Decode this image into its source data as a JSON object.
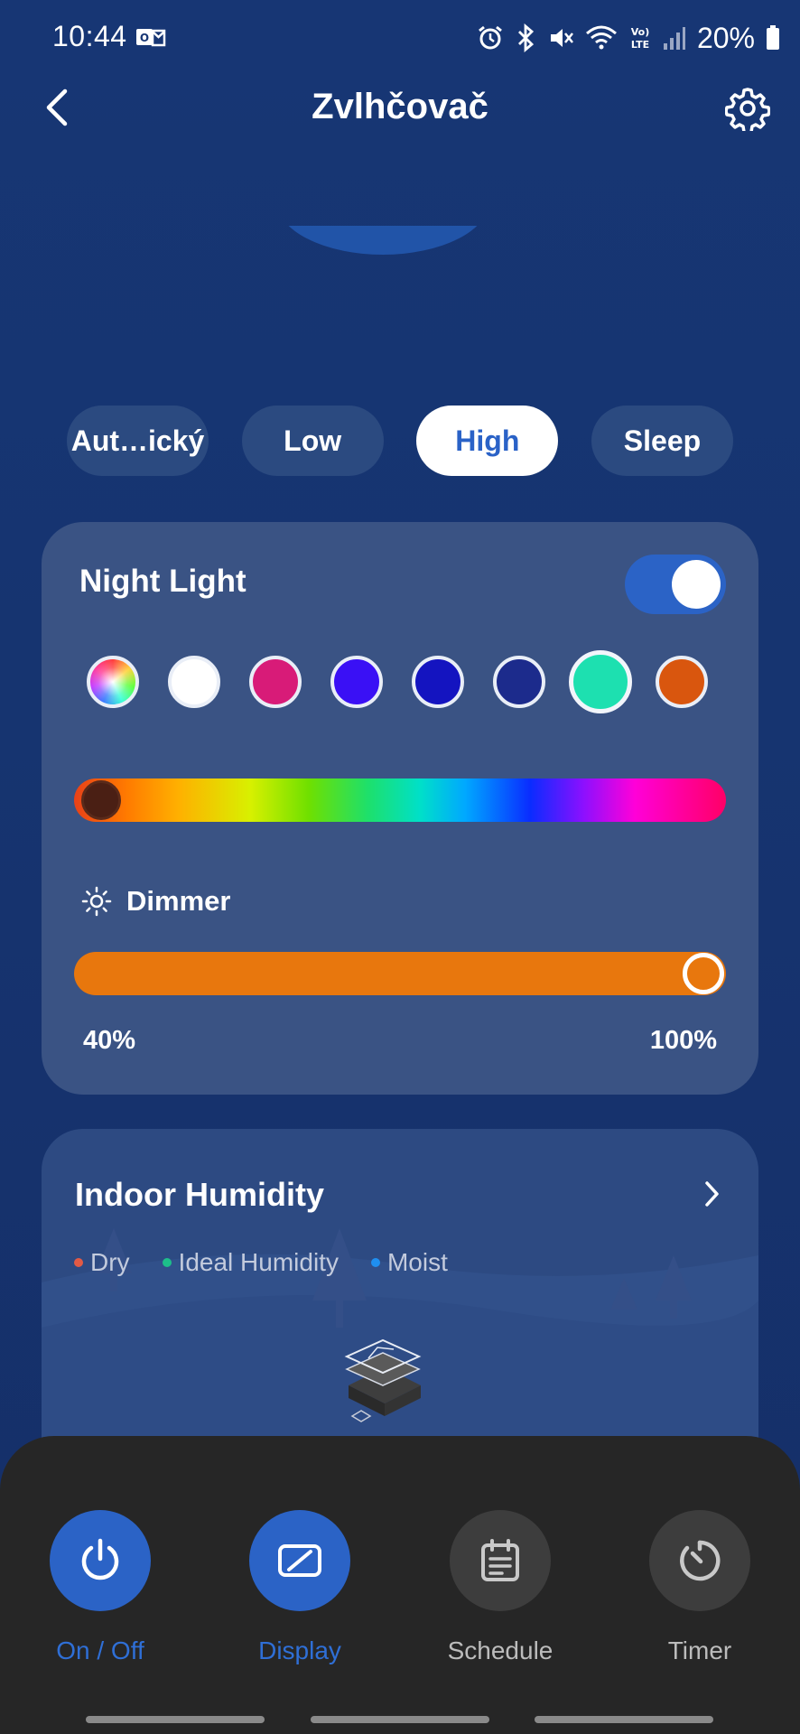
{
  "status_bar": {
    "time": "10:44",
    "battery_percent": "20%",
    "icons": [
      "outlook-notification-icon",
      "alarm-icon",
      "bluetooth-icon",
      "mute-icon",
      "wifi-icon",
      "volte-icon",
      "signal-icon",
      "battery-icon"
    ]
  },
  "header": {
    "title": "Zvlhčovač",
    "back_icon": "back-arrow-icon",
    "settings_icon": "gear-icon"
  },
  "modes": {
    "items": [
      {
        "label": "Aut…ický",
        "active": false
      },
      {
        "label": "Low",
        "active": false
      },
      {
        "label": "High",
        "active": true
      },
      {
        "label": "Sleep",
        "active": false
      }
    ]
  },
  "night_light": {
    "title": "Night Light",
    "enabled": true,
    "swatches": [
      {
        "name": "multicolor",
        "color": "rainbow"
      },
      {
        "name": "white",
        "color": "#ffffff"
      },
      {
        "name": "pink",
        "color": "#d81b78"
      },
      {
        "name": "violet-blue",
        "color": "#3a10f5"
      },
      {
        "name": "blue",
        "color": "#1414c0"
      },
      {
        "name": "navy",
        "color": "#1c2b8c"
      },
      {
        "name": "teal",
        "color": "#1de0b0",
        "selected": true
      },
      {
        "name": "orange",
        "color": "#d9560e"
      }
    ],
    "hue_value": 0.03,
    "hue_thumb_color": "#4a1f14",
    "dimmer": {
      "label": "Dimmer",
      "icon": "brightness-icon",
      "min_label": "40%",
      "max_label": "100%",
      "value_percent": 100,
      "color": "#e8770d"
    }
  },
  "indoor_humidity": {
    "title": "Indoor Humidity",
    "legend": [
      {
        "label": "Dry",
        "color": "#e25a45"
      },
      {
        "label": "Ideal Humidity",
        "color": "#1dbf8a"
      },
      {
        "label": "Moist",
        "color": "#1f8ff0"
      }
    ]
  },
  "bottom_actions": [
    {
      "label": "On / Off",
      "icon": "power-icon",
      "active": true
    },
    {
      "label": "Display",
      "icon": "display-icon",
      "active": true
    },
    {
      "label": "Schedule",
      "icon": "schedule-icon",
      "active": false
    },
    {
      "label": "Timer",
      "icon": "timer-icon",
      "active": false
    }
  ],
  "colors": {
    "background": "#163470",
    "accent": "#2b63c6",
    "card": "#3a5384"
  }
}
